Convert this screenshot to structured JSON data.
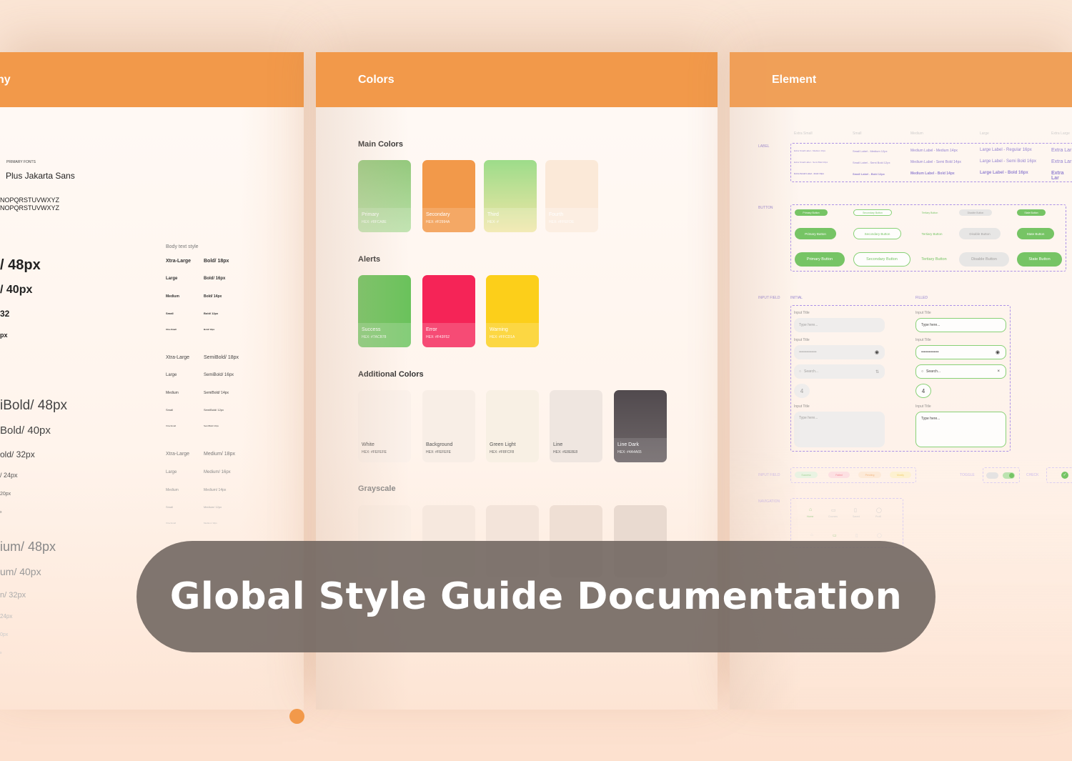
{
  "colors": {
    "accent": "#f2994a",
    "banner_bg": "#6e645f",
    "success_green": "#6bc25c"
  },
  "banner": {
    "title": "Global Style Guide Documentation"
  },
  "typography_panel": {
    "header": "hy",
    "primary_fonts_label": "PRIMARY FONTS",
    "font_name": "Plus Jakarta Sans",
    "alphabet_upper_1": "NOPQRSTUVWXYZ",
    "alphabet_upper_2": "NOPQRSTUVWXYZ",
    "heading_sizes": [
      {
        "text": "/ 48px"
      },
      {
        "text": "/ 40px"
      },
      {
        "text": "32"
      },
      {
        "text": "px"
      },
      {
        "text": "iBold/ 48px"
      },
      {
        "text": "Bold/ 40px"
      },
      {
        "text": "old/ 32px"
      },
      {
        "text": "/ 24px"
      },
      {
        "text": "20px"
      },
      {
        "text": "x"
      },
      {
        "text": "ium/ 48px"
      },
      {
        "text": "um/ 40px"
      },
      {
        "text": "n/ 32px"
      },
      {
        "text": "24px"
      },
      {
        "text": "0px"
      },
      {
        "text": "x"
      }
    ],
    "body_text_style_label": "Body text style",
    "body_groups": [
      {
        "rows": [
          {
            "size": "Xtra-Large",
            "style": "Bold/ 18px"
          },
          {
            "size": "Large",
            "style": "Bold/ 16px"
          },
          {
            "size": "Medium",
            "style": "Bold/ 14px"
          },
          {
            "size": "Small",
            "style": "Bold/ 12px"
          },
          {
            "size": "Xtra-Small",
            "style": "Bold/ 10px"
          }
        ]
      },
      {
        "rows": [
          {
            "size": "Xtra-Large",
            "style": "SemiBold/ 18px"
          },
          {
            "size": "Large",
            "style": "SemiBold/ 16px"
          },
          {
            "size": "Medium",
            "style": "SemiBold/ 14px"
          },
          {
            "size": "Small",
            "style": "SemiBold/ 12px"
          },
          {
            "size": "Xtra-Small",
            "style": "SemiBold/ 10px"
          }
        ]
      },
      {
        "rows": [
          {
            "size": "Xtra-Large",
            "style": "Medium/ 18px"
          },
          {
            "size": "Large",
            "style": "Medium/ 16px"
          },
          {
            "size": "Medium",
            "style": "Medium/ 14px"
          },
          {
            "size": "Small",
            "style": "Medium/ 12px"
          },
          {
            "size": "Xtra-Small",
            "style": "Medium/ 10px"
          }
        ]
      }
    ]
  },
  "colors_panel": {
    "header": "Colors",
    "main_colors_title": "Main Colors",
    "main_colors": [
      {
        "name": "Primary",
        "hex": "HEX: #8FCA8E",
        "color": "#8fcf7f"
      },
      {
        "name": "Secondary",
        "hex": "HEX: #F2994A",
        "color": "#f2994a"
      },
      {
        "name": "Third",
        "hex": "HEX: #",
        "color": "#b8e08a"
      },
      {
        "name": "Fourth",
        "hex": "HEX: #FFEFDE",
        "color": "#fbe9d8"
      }
    ],
    "alerts_title": "Alerts",
    "alerts": [
      {
        "name": "Success",
        "hex": "HEX: #7ACB78",
        "color": "#6bc25c"
      },
      {
        "name": "Error",
        "hex": "HEX: #F43F52",
        "color": "#f52457"
      },
      {
        "name": "Warning",
        "hex": "HEX: #FFCD1A",
        "color": "#fccf1a"
      }
    ],
    "additional_title": "Additional Colors",
    "additional": [
      {
        "name": "White",
        "hex": "HEX: #FEFEFE",
        "color": "#fbf1ea"
      },
      {
        "name": "Background",
        "hex": "HEX: #FEFEFE",
        "color": "#f8eee6"
      },
      {
        "name": "Green Light",
        "hex": "HEX: #F8FCF8",
        "color": "#f8f0e4"
      },
      {
        "name": "Line",
        "hex": "HEX: #E8E8E8",
        "color": "#efe6e0"
      },
      {
        "name": "Line Dark",
        "hex": "HEX: #4A4A65",
        "color": "#5b5357"
      }
    ],
    "grayscale_title": "Grayscale"
  },
  "element_panel": {
    "header": "Element",
    "label_section": "LABEL",
    "label_columns": [
      "Extra Small",
      "Small",
      "Medium",
      "Large",
      "Extra Large"
    ],
    "label_rows": [
      [
        "Extra Small Label - Medium 10px",
        "Small Label - Medium 12px",
        "Medium Label - Medium 14px",
        "Large Label - Regular 16px",
        "Extra Lar"
      ],
      [
        "Extra Small Label - Semi Bold 10px",
        "Small Label - Semi Bold 12px",
        "Medium Label - Semi Bold 14px",
        "Large Label - Semi Bold 16px",
        "Extra Lar"
      ],
      [
        "Extra Small Label - Bold 10px",
        "Small Label - Bold 12px",
        "Medium Label - Bold 14px",
        "Large Label - Bold 16px",
        "Extra Lar"
      ]
    ],
    "button_section": "BUTTON",
    "buttons": [
      "Primary Button",
      "Secondary Button",
      "Tertiary Button",
      "Disable Button",
      "State Button"
    ],
    "input_section": "INPUT FIELD",
    "initial_label": "INITIAL",
    "filled_label": "FILLED",
    "input_title": "Input Title",
    "type_here": "Type here...",
    "password_mask": "••••••••••••••",
    "search_placeholder": "Search...",
    "stepper_value": "4",
    "input_field_2": "INPUT FIELD",
    "status_chips": [
      "Success",
      "Failed",
      "Pending",
      "Mostly"
    ],
    "toggle_label": "TOGGLE",
    "check_label": "CHECK",
    "navigation_section": "NAVIGATION",
    "nav_items": [
      "Home",
      "Courses",
      "Saved",
      "Profil"
    ]
  }
}
